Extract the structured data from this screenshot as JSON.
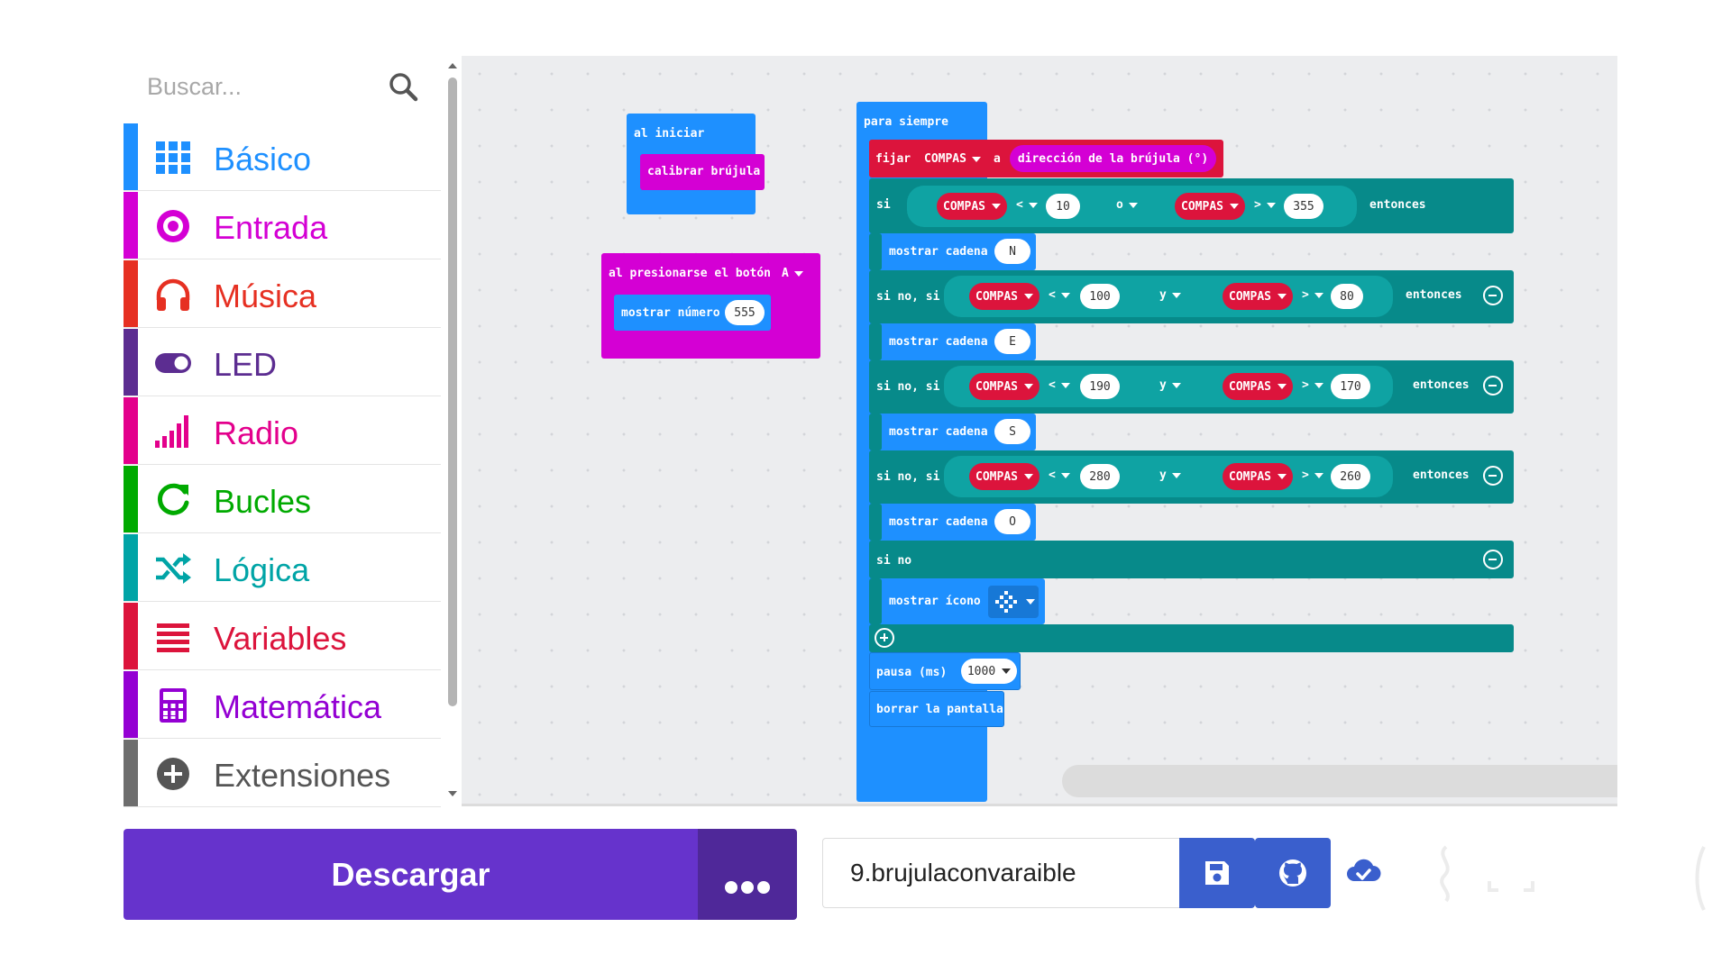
{
  "search": {
    "placeholder": "Buscar..."
  },
  "categories": [
    {
      "label": "Básico",
      "color": "#1e90ff",
      "icon": "grid-icon"
    },
    {
      "label": "Entrada",
      "color": "#d400d4",
      "icon": "target-icon"
    },
    {
      "label": "Música",
      "color": "#e63022",
      "icon": "headphones-icon"
    },
    {
      "label": "LED",
      "color": "#5c2d91",
      "icon": "toggle-icon"
    },
    {
      "label": "Radio",
      "color": "#e3008c",
      "icon": "signal-bars-icon"
    },
    {
      "label": "Bucles",
      "color": "#00aa00",
      "icon": "refresh-icon"
    },
    {
      "label": "Lógica",
      "color": "#00a4a6",
      "icon": "shuffle-icon"
    },
    {
      "label": "Variables",
      "color": "#dc143c",
      "icon": "list-lines-icon"
    },
    {
      "label": "Matemática",
      "color": "#9400d3",
      "icon": "calculator-icon"
    },
    {
      "label": "Extensiones",
      "color": "#6e6e6e",
      "icon": "plus-circle-icon"
    }
  ],
  "blocks": {
    "on_start": {
      "label": "al iniciar",
      "child": "calibrar brújula"
    },
    "on_button": {
      "label": "al presionarse el botón",
      "button": "A",
      "child": "mostrar número",
      "number": "555"
    },
    "forever": {
      "label": "para siempre",
      "set": {
        "label": "fijar",
        "var": "COMPAS",
        "to": "a",
        "value": "dirección de la brújula (°)"
      },
      "if": {
        "label": "si",
        "var": "COMPAS",
        "op1": "<",
        "n1": "10",
        "join": "o",
        "op2": ">",
        "n2": "355",
        "then": "entonces"
      },
      "show1": {
        "label": "mostrar cadena",
        "value": "N"
      },
      "elif1": {
        "label": "si no, si",
        "var": "COMPAS",
        "op1": "<",
        "n1": "100",
        "join": "y",
        "op2": ">",
        "n2": "80",
        "then": "entonces"
      },
      "show2": {
        "label": "mostrar cadena",
        "value": "E"
      },
      "elif2": {
        "label": "si no, si",
        "var": "COMPAS",
        "op1": "<",
        "n1": "190",
        "join": "y",
        "op2": ">",
        "n2": "170",
        "then": "entonces"
      },
      "show3": {
        "label": "mostrar cadena",
        "value": "S"
      },
      "elif3": {
        "label": "si no, si",
        "var": "COMPAS",
        "op1": "<",
        "n1": "280",
        "join": "y",
        "op2": ">",
        "n2": "260",
        "then": "entonces"
      },
      "show4": {
        "label": "mostrar cadena",
        "value": "O"
      },
      "else": {
        "label": "si no"
      },
      "icon": {
        "label": "mostrar ícono"
      },
      "pause": {
        "label": "pausa (ms)",
        "value": "1000"
      },
      "clear": {
        "label": "borrar la pantalla"
      }
    }
  },
  "bottom": {
    "download": "Descargar",
    "project_name": "9.brujulaconvaraible"
  },
  "colors": {
    "basic": "#1e90ff",
    "input": "#d400d4",
    "variables": "#dc143c",
    "logic": "#078a8a",
    "download": "#6633cc",
    "more": "#4f2899",
    "save": "#3a5fcd"
  }
}
